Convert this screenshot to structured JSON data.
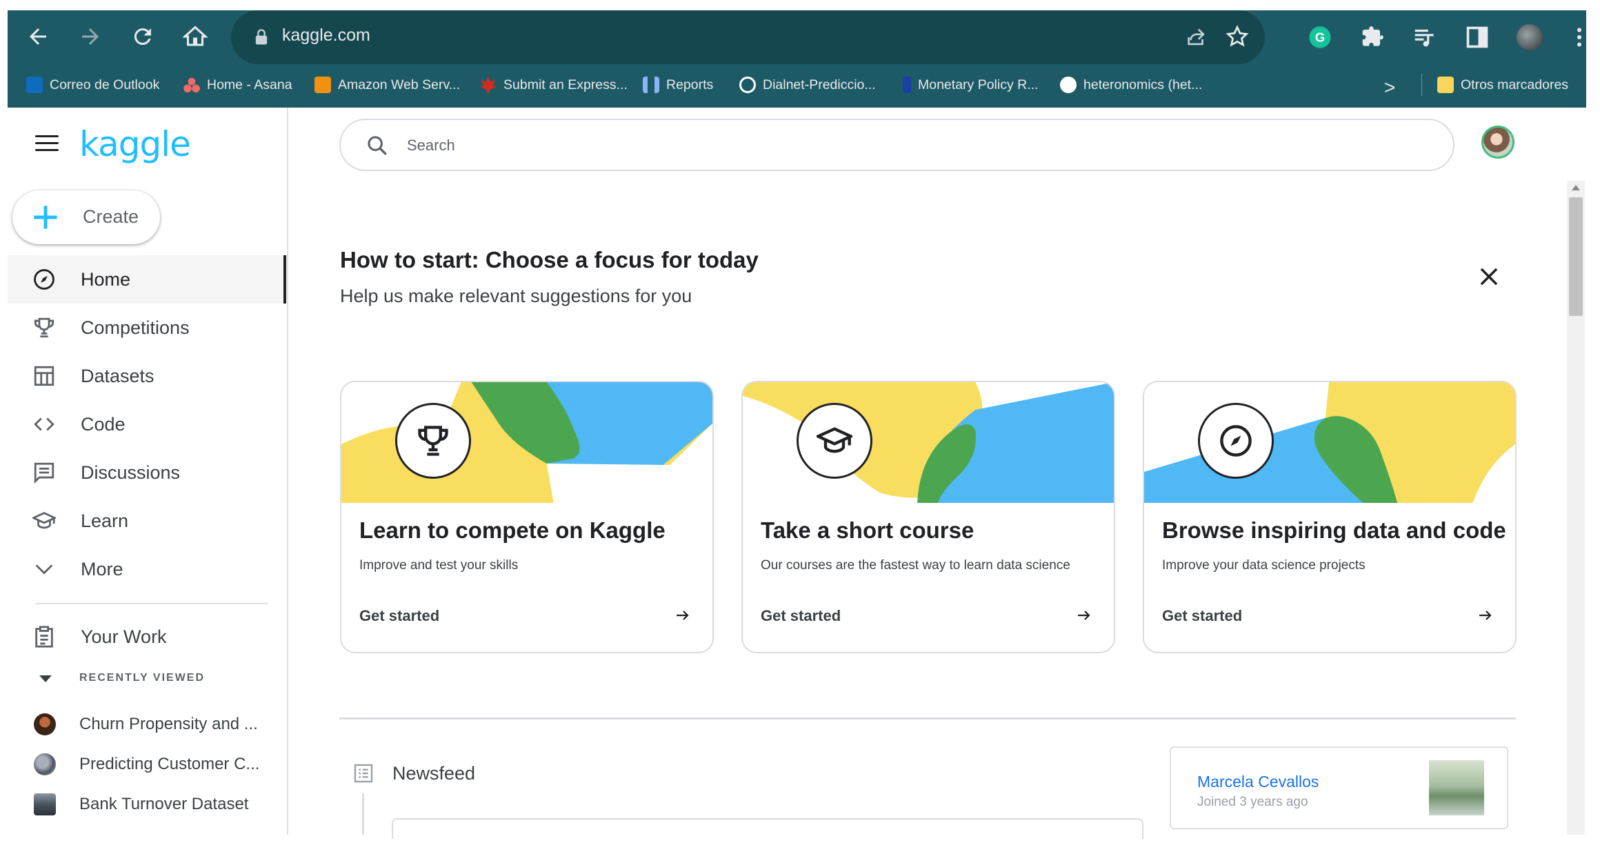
{
  "browser": {
    "url": "kaggle.com",
    "bookmarks": [
      {
        "label": "Correo de Outlook",
        "color": "#0f6cbd"
      },
      {
        "label": "Home - Asana",
        "color": "#f06a6a"
      },
      {
        "label": "Amazon Web Serv...",
        "color": "#f29111"
      },
      {
        "label": "Submit an Express...",
        "color": "#d52b1e"
      },
      {
        "label": "Reports",
        "color": "#8ab4f8"
      },
      {
        "label": "Dialnet-Prediccio...",
        "color": "#ffffff"
      },
      {
        "label": "Monetary Policy R...",
        "color": "#1a3fa6"
      },
      {
        "label": "heteronomics (het...",
        "color": "#ffffff"
      },
      {
        "label": "Otros marcadores",
        "color": "#f9d55b"
      }
    ],
    "overflow_symbol": ">"
  },
  "sidebar": {
    "logo": "kaggle",
    "create_label": "Create",
    "nav": [
      {
        "label": "Home",
        "icon": "compass-icon",
        "active": true
      },
      {
        "label": "Competitions",
        "icon": "trophy-icon"
      },
      {
        "label": "Datasets",
        "icon": "table-icon"
      },
      {
        "label": "Code",
        "icon": "code-icon"
      },
      {
        "label": "Discussions",
        "icon": "discussions-icon"
      },
      {
        "label": "Learn",
        "icon": "graduation-cap-icon"
      },
      {
        "label": "More",
        "icon": "chevron-down-icon"
      }
    ],
    "your_work": "Your Work",
    "recently_viewed_label": "RECENTLY VIEWED",
    "recent": [
      {
        "label": "Churn Propensity and ..."
      },
      {
        "label": "Predicting Customer C..."
      },
      {
        "label": "Bank Turnover Dataset"
      }
    ]
  },
  "main": {
    "search_placeholder": "Search",
    "focus_title": "How to start: Choose a focus for today",
    "focus_subtitle": "Help us make relevant suggestions for you",
    "cards": [
      {
        "title": "Learn to compete on Kaggle",
        "desc": "Improve and test your skills",
        "cta": "Get started",
        "icon": "trophy-icon"
      },
      {
        "title": "Take a short course",
        "desc": "Our courses are the fastest way to learn data science",
        "cta": "Get started",
        "icon": "graduation-cap-icon"
      },
      {
        "title": "Browse inspiring data and code",
        "desc": "Improve your data science projects",
        "cta": "Get started",
        "icon": "compass-icon"
      }
    ],
    "newsfeed_label": "Newsfeed",
    "profile": {
      "name": "Marcela Cevallos",
      "joined": "Joined 3 years ago"
    }
  },
  "colors": {
    "chrome": "#1e5a66",
    "kaggle_blue": "#20beff",
    "yellow": "#f8dd5e",
    "green": "#4ca64f",
    "sky": "#4fb8f5"
  }
}
